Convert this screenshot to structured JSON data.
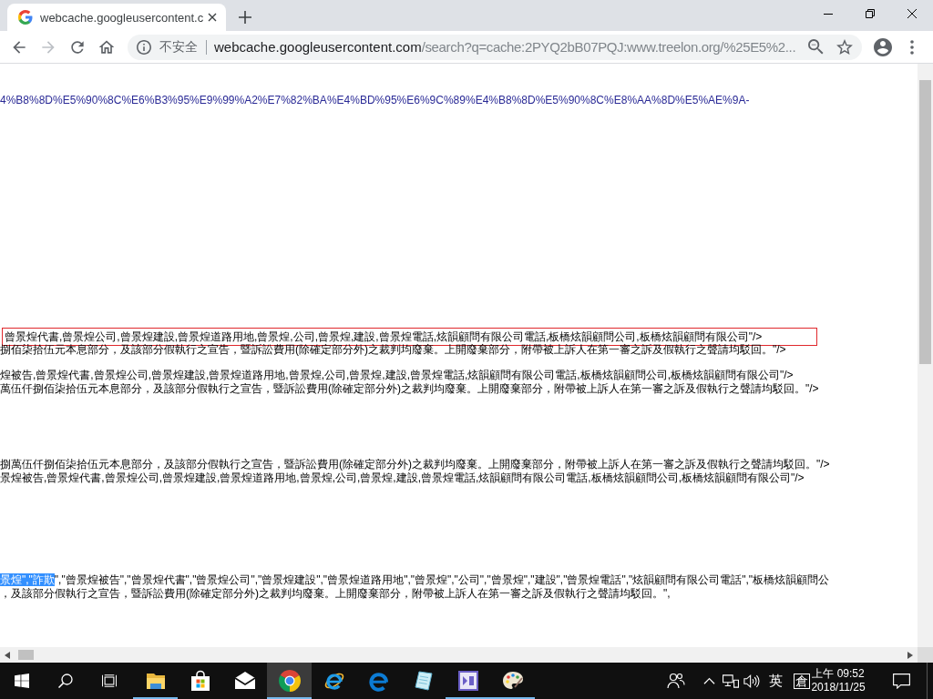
{
  "browser": {
    "tabs": [
      {
        "title": "webcache.googleusercontent.c",
        "selected": true
      }
    ],
    "nav_buttons": [
      {
        "kind": "back",
        "disabled": false
      },
      {
        "kind": "forward",
        "disabled": true
      },
      {
        "kind": "reload",
        "disabled": false
      },
      {
        "kind": "home",
        "disabled": false
      }
    ],
    "address_bar": {
      "security_label": "不安全",
      "host": "webcache.googleusercontent.com",
      "path": "/search?q=cache:2PYQ2bB07PQJ:www.treelon.org/%25E5%2..."
    }
  },
  "page": {
    "blocks": [
      {
        "lines": [
          {
            "kind": "link",
            "outlined": false,
            "segments": [
              {
                "text": "4%B8%8D%E5%90%8C%E6%B3%95%E9%99%A2%E7%82%BA%E4%BD%95%E6%9C%89%E4%B8%8D%E5%90%8C%E8%AA%8D%E5%AE%9A-",
                "selected": false
              }
            ]
          }
        ]
      },
      {
        "lines": [
          {
            "kind": "text",
            "outlined": true,
            "segments": [
              {
                "text": "曾景煌代書,曾景煌公司,曾景煌建設,曾景煌道路用地,曾景煌,公司,曾景煌,建設,曾景煌電話,炫韻顧問有限公司電話,板橋炫韻顧問公司,板橋炫韻顧問有限公司\"/>",
                "selected": false
              }
            ]
          },
          {
            "kind": "text",
            "outlined": false,
            "segments": [
              {
                "text": "捌佰柒拾伍元本息部分，及該部分假執行之宣告，暨訴訟費用(除確定部分外)之裁判均廢棄。上開廢棄部分，附帶被上訴人在第一審之訴及假執行之聲請均駁回。\"/>",
                "selected": false
              }
            ]
          }
        ]
      },
      {
        "lines": [
          {
            "kind": "text",
            "outlined": false,
            "segments": [
              {
                "text": "煌被告,曾景煌代書,曾景煌公司,曾景煌建設,曾景煌道路用地,曾景煌,公司,曾景煌,建設,曾景煌電話,炫韻顧問有限公司電話,板橋炫韻顧問公司,板橋炫韻顧問有限公司\"/>",
                "selected": false
              }
            ]
          },
          {
            "kind": "text",
            "outlined": false,
            "segments": [
              {
                "text": "萬伍仟捌佰柒拾伍元本息部分，及該部分假執行之宣告，暨訴訟費用(除確定部分外)之裁判均廢棄。上開廢棄部分，附帶被上訴人在第一審之訴及假執行之聲請均駁回。\"/>",
                "selected": false
              }
            ]
          }
        ]
      },
      {
        "lines": [
          {
            "kind": "text",
            "outlined": false,
            "segments": [
              {
                "text": "捌萬伍仟捌佰柒拾伍元本息部分，及該部分假執行之宣告，暨訴訟費用(除確定部分外)之裁判均廢棄。上開廢棄部分，附帶被上訴人在第一審之訴及假執行之聲請均駁回。\"/>",
                "selected": false
              }
            ]
          },
          {
            "kind": "text",
            "outlined": false,
            "segments": [
              {
                "text": "景煌被告,曾景煌代書,曾景煌公司,曾景煌建設,曾景煌道路用地,曾景煌,公司,曾景煌,建設,曾景煌電話,炫韻顧問有限公司電話,板橋炫韻顧問公司,板橋炫韻顧問有限公司\"/>",
                "selected": false
              }
            ]
          }
        ]
      },
      {
        "lines": [
          {
            "kind": "text",
            "outlined": false,
            "segments": [
              {
                "text": "景煌\",\"詐欺",
                "selected": true
              },
              {
                "text": "\",\"曾景煌被告\",\"曾景煌代書\",\"曾景煌公司\",\"曾景煌建設\",\"曾景煌道路用地\",\"曾景煌\",\"公司\",\"曾景煌\",\"建設\",\"曾景煌電話\",\"炫韻顧問有限公司電話\",\"板橋炫韻顧問公",
                "selected": false
              }
            ]
          },
          {
            "kind": "text",
            "outlined": false,
            "segments": [
              {
                "text": "，及該部分假執行之宣告，暨訴訟費用(除確定部分外)之裁判均廢棄。上開廢棄部分，附帶被上訴人在第一審之訴及假執行之聲請均駁回。\",",
                "selected": false
              }
            ]
          }
        ]
      }
    ]
  },
  "taskbar": {
    "apps": [
      {
        "kind": "folder",
        "running": true,
        "selected": false
      },
      {
        "kind": "store",
        "running": false,
        "selected": false
      },
      {
        "kind": "mail",
        "running": false,
        "selected": false
      },
      {
        "kind": "chrome",
        "running": true,
        "selected": true
      },
      {
        "kind": "ie",
        "running": false,
        "selected": false
      },
      {
        "kind": "edge",
        "running": false,
        "selected": false
      },
      {
        "kind": "notes",
        "running": false,
        "selected": false
      },
      {
        "kind": "studio",
        "running": true,
        "selected": false
      },
      {
        "kind": "paint",
        "running": true,
        "selected": false
      }
    ],
    "tray": {
      "language": "英",
      "input_mode": "倉",
      "time": "上午 09:52",
      "date": "2018/11/25"
    }
  }
}
